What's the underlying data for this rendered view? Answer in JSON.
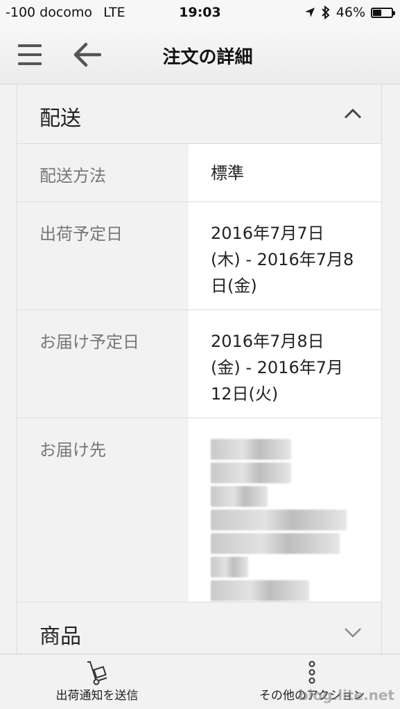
{
  "status_bar": {
    "carrier": "-100 docomo",
    "network": "LTE",
    "time": "19:03",
    "battery": "46%",
    "battery_level": 0.46
  },
  "app_bar": {
    "title": "注文の詳細"
  },
  "shipping_section": {
    "title": "配送",
    "rows": [
      {
        "label": "配送方法",
        "value": "標準"
      },
      {
        "label": "出荷予定日",
        "value_lines": [
          "2016年7月7日",
          "(木) - 2016年7月8",
          "日(金)"
        ]
      },
      {
        "label": "お届け予定日",
        "value_lines": [
          "2016年7月8日",
          "(金) - 2016年7月",
          "12日(火)"
        ]
      },
      {
        "label": "お届け先"
      }
    ]
  },
  "products_section": {
    "title": "商品"
  },
  "bottom_bar": {
    "left_label": "出荷通知を送信",
    "right_label": "その他のアクション"
  },
  "watermark": "blog.lite.net",
  "colors": {
    "background": "#f2f2f2",
    "text": "#222222",
    "label_text": "#777777"
  }
}
